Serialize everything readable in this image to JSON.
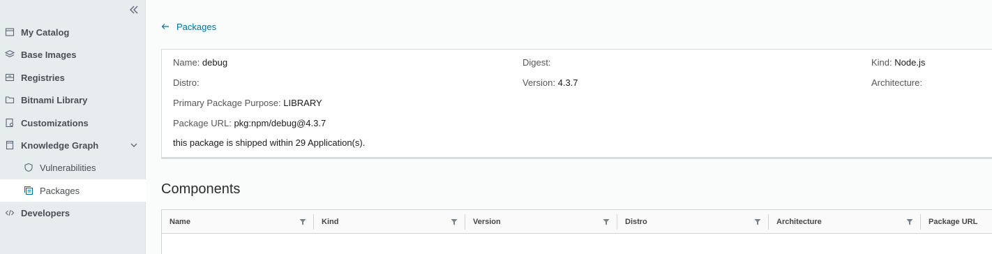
{
  "sidebar": {
    "collapse_icon": "double-chevron-left-icon",
    "items": [
      {
        "label": "My Catalog",
        "icon": "catalog-icon"
      },
      {
        "label": "Base Images",
        "icon": "layers-icon"
      },
      {
        "label": "Registries",
        "icon": "registry-icon"
      },
      {
        "label": "Bitnami Library",
        "icon": "folder-icon"
      },
      {
        "label": "Customizations",
        "icon": "customize-icon"
      },
      {
        "label": "Knowledge Graph",
        "icon": "book-icon",
        "expanded": true
      },
      {
        "label": "Vulnerabilities",
        "icon": "shield-icon"
      },
      {
        "label": "Packages",
        "icon": "packages-icon",
        "active": true
      },
      {
        "label": "Developers",
        "icon": "code-icon"
      }
    ]
  },
  "back": {
    "label": "Packages"
  },
  "details": {
    "name_label": "Name:",
    "name_value": "debug",
    "digest_label": "Digest:",
    "digest_value": "",
    "kind_label": "Kind:",
    "kind_value": "Node.js",
    "distro_label": "Distro:",
    "distro_value": "",
    "version_label": "Version:",
    "version_value": "4.3.7",
    "architecture_label": "Architecture:",
    "architecture_value": "",
    "purpose_label": "Primary Package Purpose:",
    "purpose_value": "LIBRARY",
    "purl_label": "Package URL:",
    "purl_value": "pkg:npm/debug@4.3.7",
    "note": "this package is shipped within 29 Application(s)."
  },
  "components": {
    "title": "Components",
    "columns": [
      "Name",
      "Kind",
      "Version",
      "Distro",
      "Architecture",
      "Package URL"
    ]
  },
  "colors": {
    "link": "#0072a3",
    "sidebar_bg": "#e7ecef",
    "active_bg": "#ffffff"
  }
}
